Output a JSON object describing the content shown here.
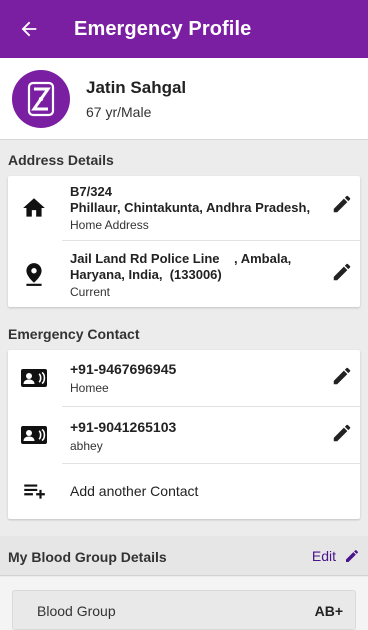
{
  "header": {
    "title": "Emergency Profile",
    "back_icon": "arrow-back-icon"
  },
  "profile": {
    "name": "Jatin Sahgal",
    "details": "67 yr/Male",
    "avatar_letter": "Z",
    "avatar_color": "#7b1fa2"
  },
  "address": {
    "section_title": "Address Details",
    "items": [
      {
        "line1": "B7/324",
        "line2": "Phillaur, Chintakunta, Andhra Pradesh,",
        "label": "Home Address",
        "icon": "home-icon"
      },
      {
        "line1": "Jail Land Rd Police Line    , Ambala,",
        "line2": "Haryana, India,  (133006)",
        "label": "Current",
        "icon": "location-pin-icon"
      }
    ]
  },
  "emergency": {
    "section_title": "Emergency Contact",
    "contacts": [
      {
        "phone": "+91-9467696945",
        "name": "Homee",
        "icon": "contact-phone-icon"
      },
      {
        "phone": "+91-9041265103",
        "name": "abhey",
        "icon": "contact-phone-icon"
      }
    ],
    "add_label": "Add another Contact"
  },
  "blood": {
    "section_title": "My Blood Group Details",
    "edit_label": "Edit",
    "field_label": "Blood Group",
    "value": "AB+"
  },
  "colors": {
    "primary": "#7b1fa2",
    "accent_text": "#4a148c",
    "background": "#ececec"
  }
}
